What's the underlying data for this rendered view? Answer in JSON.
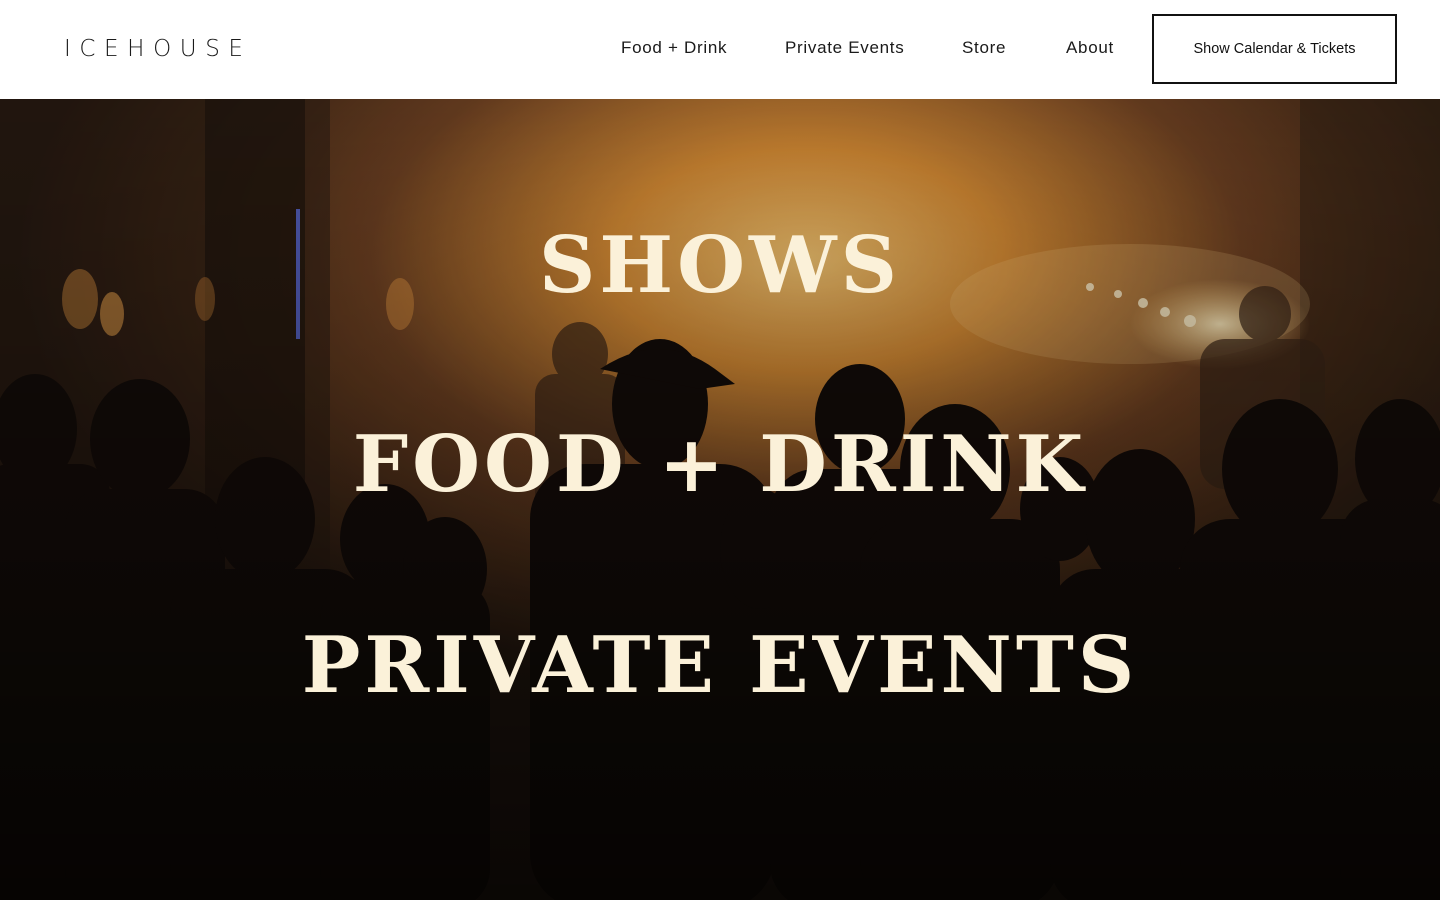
{
  "header": {
    "logo": "ICEHOUSE",
    "nav": {
      "food_drink": "Food + Drink",
      "private_events": "Private Events",
      "store": "Store",
      "about": "About"
    },
    "cta_label": "Show Calendar & Tickets"
  },
  "hero": {
    "lines": {
      "shows": "SHOWS",
      "food_drink": "FOOD + DRINK",
      "private_events": "PRIVATE EVENTS"
    },
    "colors": {
      "headline": "#fbf1d9",
      "stage_glow": "#e8a63a",
      "shadow": "#1c1510"
    }
  }
}
